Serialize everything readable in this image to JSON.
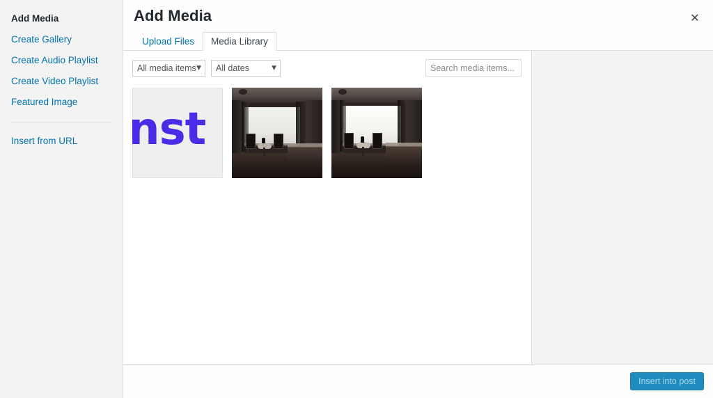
{
  "modal": {
    "title": "Add Media",
    "close_label": "✕"
  },
  "menu": {
    "items": [
      {
        "label": "Add Media",
        "active": true
      },
      {
        "label": "Create Gallery",
        "active": false
      },
      {
        "label": "Create Audio Playlist",
        "active": false
      },
      {
        "label": "Create Video Playlist",
        "active": false
      },
      {
        "label": "Featured Image",
        "active": false
      }
    ],
    "secondary": [
      {
        "label": "Insert from URL"
      }
    ]
  },
  "tabs": [
    {
      "label": "Upload Files",
      "active": false
    },
    {
      "label": "Media Library",
      "active": true
    }
  ],
  "toolbar": {
    "filter_type": "All media items",
    "filter_type_caret": "▼",
    "filter_date": "All dates",
    "filter_date_caret": "▼",
    "search_value": "",
    "search_placeholder": "Search media items..."
  },
  "attachments": [
    {
      "name": "nst-logo",
      "type": "logo",
      "logo_text": "nst"
    },
    {
      "name": "hotel-room-photo-1",
      "type": "photo",
      "variant": "a"
    },
    {
      "name": "hotel-room-photo-2",
      "type": "photo",
      "variant": "b"
    }
  ],
  "footer": {
    "insert_label": "Insert into post"
  },
  "colors": {
    "link": "#0073aa",
    "sidebar_bg": "#f3f3f3",
    "button_bg": "#1e8cbe",
    "button_text": "#a8d6ea",
    "logo_blue": "#4b2ae8",
    "border": "#dddddd"
  }
}
